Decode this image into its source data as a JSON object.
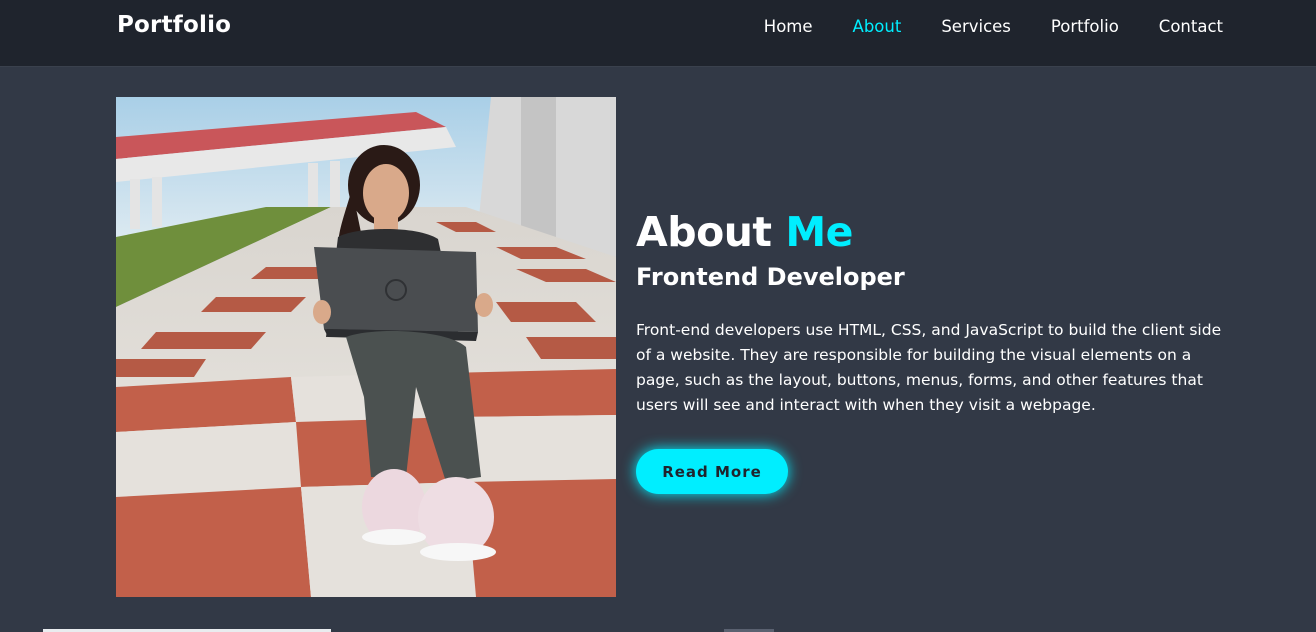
{
  "header": {
    "logo": "Portfolio",
    "nav": [
      {
        "label": "Home",
        "active": false
      },
      {
        "label": "About",
        "active": true
      },
      {
        "label": "Services",
        "active": false
      },
      {
        "label": "Portfolio",
        "active": false
      },
      {
        "label": "Contact",
        "active": false
      }
    ]
  },
  "about": {
    "heading_main": "About",
    "heading_accent": "Me",
    "subheading": "Frontend Developer",
    "paragraph": "Front-end developers use HTML, CSS, and JavaScript to build the client side of a website. They are responsible for building the visual elements on a page, such as the layout, buttons, menus, forms, and other features that users will see and interact with when they visit a webpage.",
    "button_label": "Read More"
  },
  "photo": {
    "icon": "profile-photo"
  },
  "colors": {
    "background": "#323946",
    "header": "#1f242d",
    "accent": "#00eeff",
    "text": "#ffffff"
  }
}
